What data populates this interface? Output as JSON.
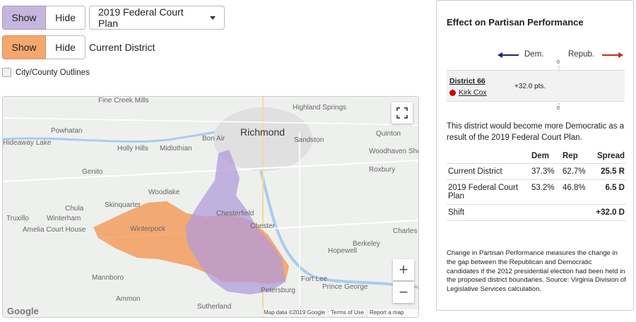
{
  "plan_toggle": {
    "show_label": "Show",
    "hide_label": "Hide"
  },
  "plan_dropdown": {
    "selected": "2019 Federal Court Plan"
  },
  "current_toggle": {
    "show_label": "Show",
    "hide_label": "Hide",
    "label": "Current District"
  },
  "outlines": {
    "label": "City/County Outlines"
  },
  "map": {
    "city": "Richmond",
    "labels": [
      "Fine Creek Mills",
      "Powhatan",
      "Holly Hills",
      "Midlothian",
      "Bon Air",
      "Highland Springs",
      "Sandston",
      "Quinton",
      "Hideaway Lake",
      "Genito",
      "Woodhaven Shores",
      "Roxbury",
      "Woodlake",
      "Chula",
      "Skinquarter",
      "Truxillo",
      "Winterham",
      "Amelia Court House",
      "Winterpock",
      "Chesterfield",
      "Chester",
      "Hopewell",
      "Berkeley",
      "Charles City",
      "Mannboro",
      "Ammon",
      "Fort Lee",
      "Prince George",
      "Petersburg",
      "Sutherland"
    ],
    "zoom_in": "+",
    "zoom_out": "−",
    "google": "Google",
    "attribution": [
      "Map data ©2019 Google",
      "Terms of Use",
      "Report a map error"
    ]
  },
  "panel": {
    "title": "Effect on Partisan Performance",
    "dem_label": "Dem.",
    "rep_label": "Repub.",
    "zero_top": "0",
    "zero_bottom": "0",
    "district": "District 66",
    "candidate": "Kirk Cox",
    "shift_pts": "+32.0 pts.",
    "summary": "This district would become more Democratic as a result of the 2019 Federal Court Plan.",
    "table": {
      "headers": [
        "",
        "Dem",
        "Rep",
        "Spread"
      ],
      "rows": [
        [
          "Current District",
          "37.3%",
          "62.7%",
          "25.5 R"
        ],
        [
          "2019 Federal Court Plan",
          "53.2%",
          "46.8%",
          "6.5 D"
        ],
        [
          "Shift",
          "",
          "",
          "+32.0 D"
        ]
      ]
    },
    "footnote": "Change in Partisan Performance measures the change in the gap between the Republican and Democratic candidates if the 2012 presidential election had been held in the proposed district boundaries. Source: Virginia Division of Legislative Services calculation."
  },
  "colors": {
    "dem": "#1a237e",
    "rep": "#c62828",
    "plan_fill": "#b19cd9",
    "current_fill": "#f4914a"
  }
}
